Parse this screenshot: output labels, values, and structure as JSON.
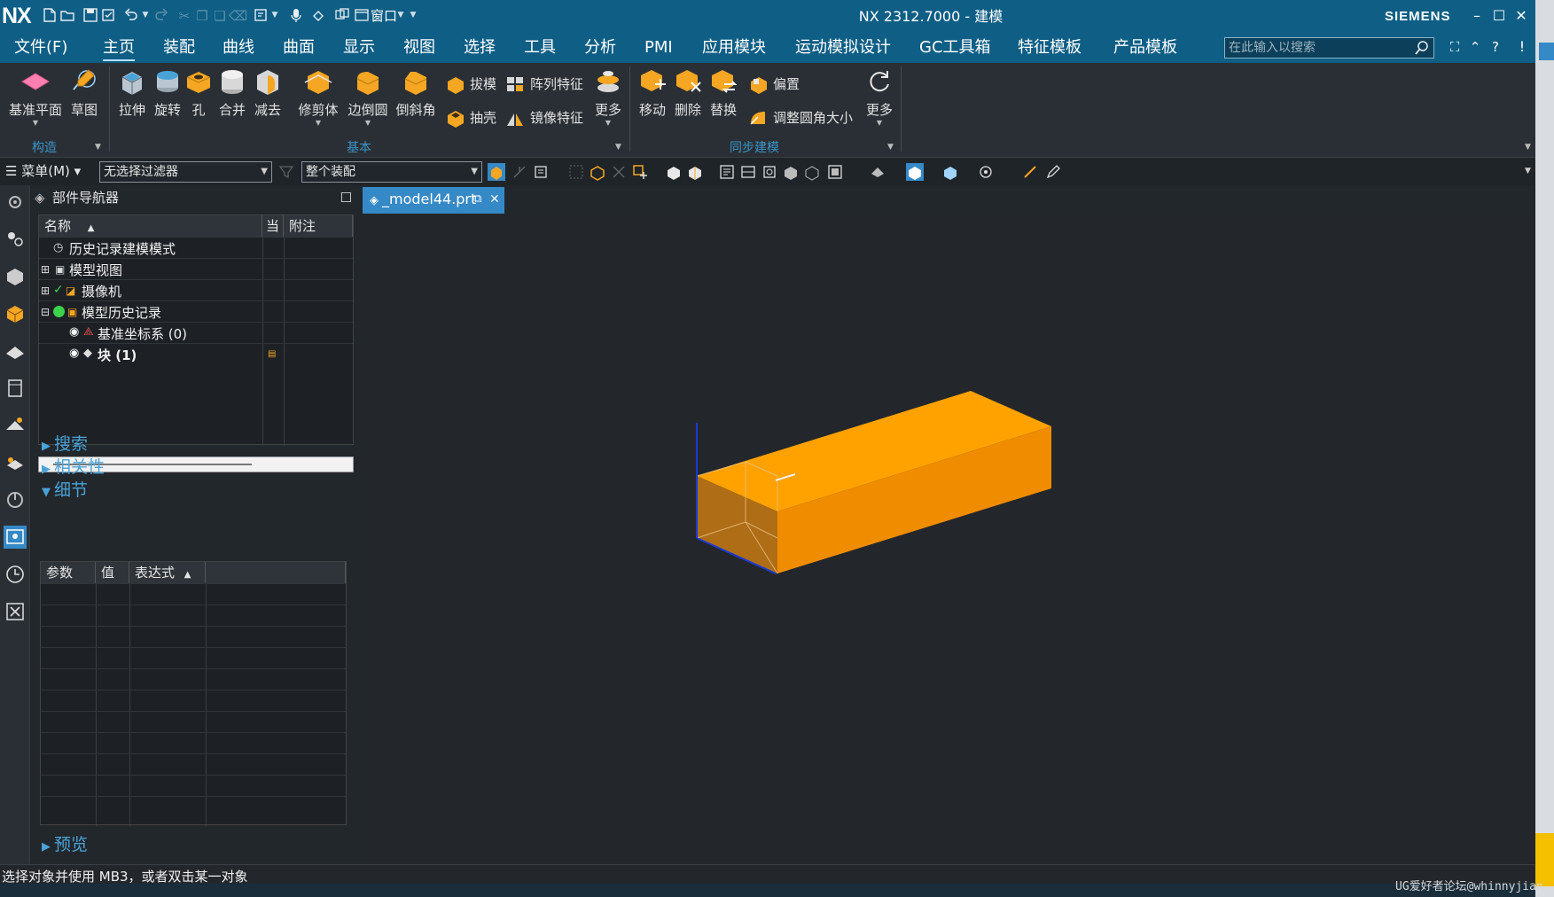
{
  "app": {
    "logo": "NX",
    "window_title": "NX 2312.7000 - 建模",
    "brand": "SIEMENS"
  },
  "menubar": {
    "items": [
      "文件(F)",
      "主页",
      "装配",
      "曲线",
      "曲面",
      "显示",
      "视图",
      "选择",
      "工具",
      "分析",
      "PMI",
      "应用模块",
      "运动模拟设计",
      "GC工具箱",
      "特征模板",
      "产品模板"
    ],
    "active": "主页",
    "search_placeholder": "在此输入以搜索"
  },
  "ribbon": {
    "construct_group": {
      "label": "构造",
      "buttons": [
        "基准平面",
        "草图"
      ]
    },
    "basic_group": {
      "label": "基本",
      "buttons": [
        "拉伸",
        "旋转",
        "孔",
        "合并",
        "减去",
        "修剪体",
        "边倒圆",
        "倒斜角"
      ],
      "small_buttons": [
        "拔模",
        "阵列特征",
        "抽壳",
        "镜像特征"
      ],
      "more": "更多"
    },
    "sync_group": {
      "label": "同步建模",
      "buttons": [
        "移动",
        "删除",
        "替换"
      ],
      "small_buttons": [
        "偏置",
        "调整圆角大小"
      ],
      "more": "更多"
    }
  },
  "toolbar": {
    "menu_label": "菜单(M)",
    "filter_value": "无选择过滤器",
    "scope_value": "整个装配"
  },
  "navigator": {
    "title": "部件导航器",
    "columns": [
      "名称",
      "当",
      "附注"
    ],
    "rows": [
      {
        "label": "历史记录建模模式"
      },
      {
        "label": "模型视图"
      },
      {
        "label": "摄像机"
      },
      {
        "label": "模型历史记录"
      },
      {
        "label": "基准坐标系 (0)"
      },
      {
        "label": "块 (1)"
      }
    ],
    "sections": {
      "search": "搜索",
      "dependencies": "相关性",
      "details": "细节",
      "preview": "预览"
    },
    "details_columns": [
      "参数",
      "值",
      "表达式"
    ]
  },
  "graphics": {
    "tab_label": "_model44.prt"
  },
  "model": {
    "body_color_top": "#ffa200",
    "body_color_side": "#f08c00",
    "body_color_front": "#c87a12"
  },
  "status": {
    "text": "选择对象并使用 MB3，或者双击某一对象",
    "watermark": "UG爱好者论坛@whinnyjian"
  },
  "colors": {
    "titlebar": "#0e5e85",
    "accent": "#3589c6",
    "section_link": "#4aa3d7"
  }
}
